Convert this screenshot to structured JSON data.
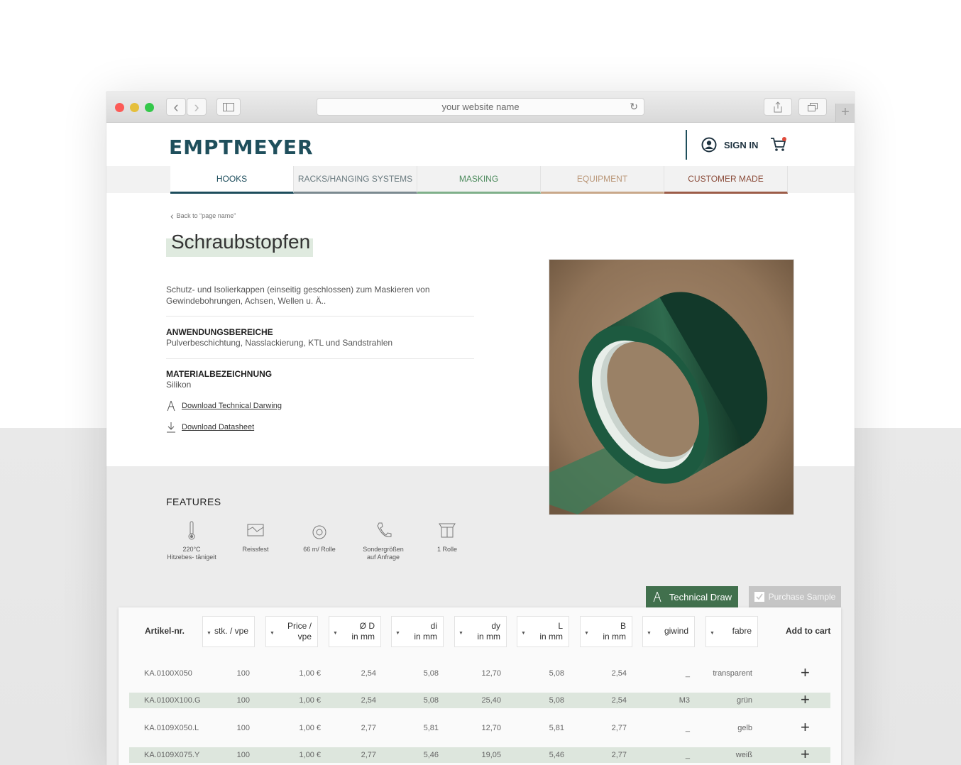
{
  "browser": {
    "url_placeholder": "your website name",
    "back_icon": "‹",
    "forward_icon": "›",
    "reload_icon": "↻",
    "new_tab_icon": "+"
  },
  "header": {
    "logo": "EMPTMEYER",
    "sign_in": "SIGN IN"
  },
  "nav": {
    "items": [
      "HOOKS",
      "RACKS/HANGING SYSTEMS",
      "MASKING",
      "EQUIPMENT",
      "CUSTOMER MADE"
    ],
    "active": "HOOKS"
  },
  "product": {
    "back_link": "Back to “page name”",
    "title": "Schraubstopfen",
    "description": "Schutz- und Isolierkappen (einseitig geschlossen) zum Maskieren von Gewindebohrungen, Achsen, Wellen u. Ä..",
    "application_label": "ANWENDUNGSBEREICHE",
    "application_value": "Pulverbeschichtung, Nasslackierung, KTL und Sandstrahlen",
    "material_label": "MATERIALBEZEICHNUNG",
    "material_value": "Silikon",
    "download_drawing": "Download Technical Darwing",
    "download_datasheet": "Download Datasheet"
  },
  "features": {
    "title": "FEATURES",
    "items": [
      {
        "icon": "thermometer-icon",
        "label": "220°C\nHitzebes- tänigeit"
      },
      {
        "icon": "tear-resistant-icon",
        "label": "Reissfest"
      },
      {
        "icon": "roll-icon",
        "label": "66 m/ Rolle"
      },
      {
        "icon": "phone-icon",
        "label": "Sondergrößen\nauf Anfrage"
      },
      {
        "icon": "box-icon",
        "label": "1 Rolle"
      }
    ]
  },
  "actions": {
    "technical_draw": "Technical Draw",
    "purchase_sample": "Purchase Sample"
  },
  "table": {
    "headers": {
      "artikel": "Artikel-nr.",
      "stk": "stk. / vpe",
      "price": "Price /\nvpe",
      "d": "Ø D\nin mm",
      "di": "di\nin mm",
      "dy": "dy\nin mm",
      "l": "L\nin mm",
      "b": "B\nin mm",
      "giwind": "giwind",
      "fabre": "fabre",
      "cart": "Add to cart"
    },
    "rows": [
      {
        "art": "KA.0100X050",
        "stk": "100",
        "price": "1,00 €",
        "d": "2,54",
        "di": "5,08",
        "dy": "12,70",
        "l": "5,08",
        "b": "2,54",
        "g": "_",
        "f": "transparent"
      },
      {
        "art": "KA.0100X100.G",
        "stk": "100",
        "price": "1,00 €",
        "d": "2,54",
        "di": "5,08",
        "dy": "25,40",
        "l": "5,08",
        "b": "2,54",
        "g": "M3",
        "f": "grün"
      },
      {
        "art": "KA.0109X050.L",
        "stk": "100",
        "price": "1,00 €",
        "d": "2,77",
        "di": "5,81",
        "dy": "12,70",
        "l": "5,81",
        "b": "2,77",
        "g": "_",
        "f": "gelb"
      },
      {
        "art": "KA.0109X075.Y",
        "stk": "100",
        "price": "1,00 €",
        "d": "2,77",
        "di": "5,46",
        "dy": "19,05",
        "l": "5,46",
        "b": "2,77",
        "g": "_",
        "f": "weiß"
      }
    ],
    "add_icon": "+"
  }
}
